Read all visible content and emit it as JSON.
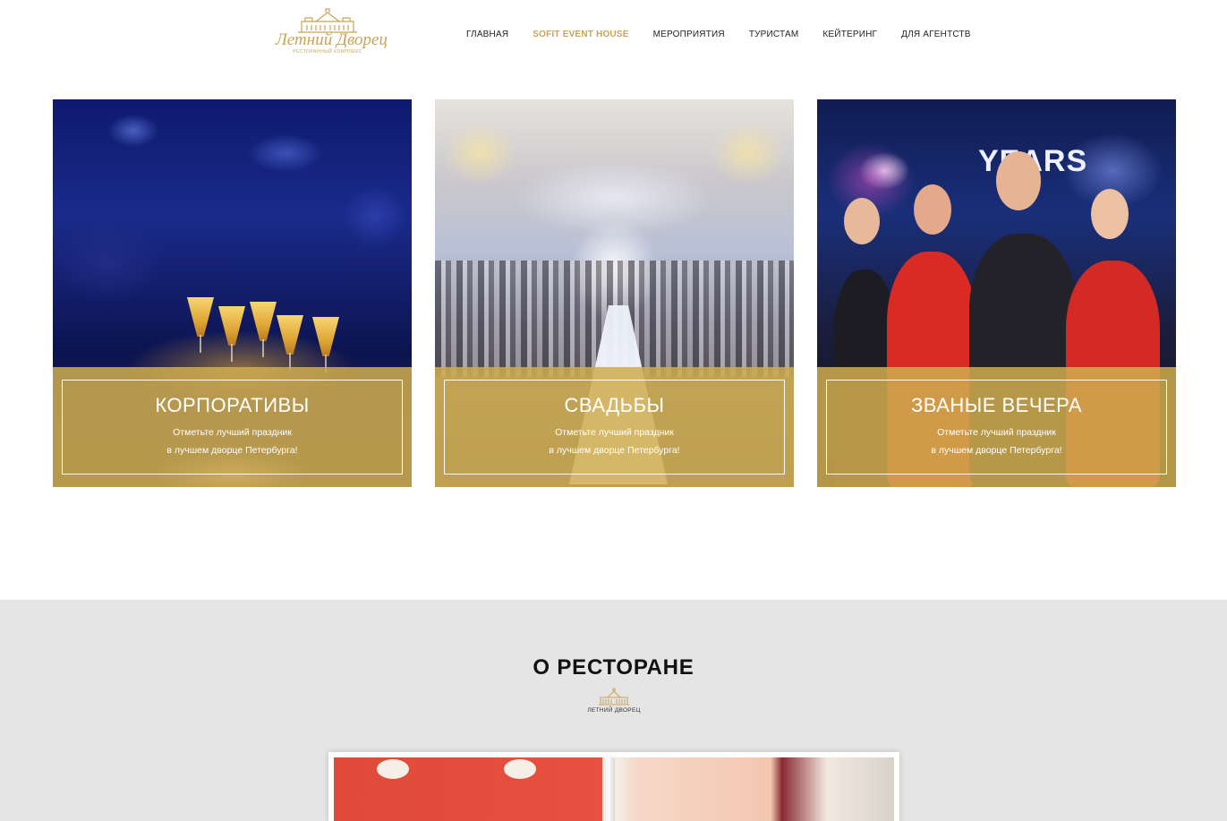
{
  "header": {
    "logo": {
      "name": "Летний Дворец",
      "subtitle": "РЕСТОРАННЫЙ КОМПЛЕКС"
    },
    "nav": [
      {
        "label": "ГЛАВНАЯ",
        "active": false
      },
      {
        "label": "SOFIT EVENT HOUSE",
        "active": true
      },
      {
        "label": "МЕРОПРИЯТИЯ",
        "active": false
      },
      {
        "label": "ТУРИСТАМ",
        "active": false
      },
      {
        "label": "КЕЙТЕРИНГ",
        "active": false
      },
      {
        "label": "ДЛЯ АГЕНТСТВ",
        "active": false
      }
    ]
  },
  "cards": [
    {
      "title": "КОРПОРАТИВЫ",
      "line1": "Отметьте лучший праздник",
      "line2": "в лучшем дворце Петербурга!"
    },
    {
      "title": "СВАДЬБЫ",
      "line1": "Отметьте лучший праздник",
      "line2": "в лучшем дворце Петербурга!"
    },
    {
      "title": "ЗВАНЫЕ ВЕЧЕРА",
      "line1": "Отметьте лучший праздник",
      "line2": "в лучшем дворце Петербурга!"
    }
  ],
  "photo_text": {
    "stage_sign": "YEARS"
  },
  "about": {
    "title": "О РЕСТОРАНЕ",
    "logo_text": "ЛЕТНИЙ ДВОРЕЦ"
  },
  "colors": {
    "accent": "#c8a454",
    "card_band": "#cfac4f",
    "about_bg": "#e6e5e5"
  },
  "icons": [
    "palace-logo-icon",
    "palace-small-icon"
  ]
}
